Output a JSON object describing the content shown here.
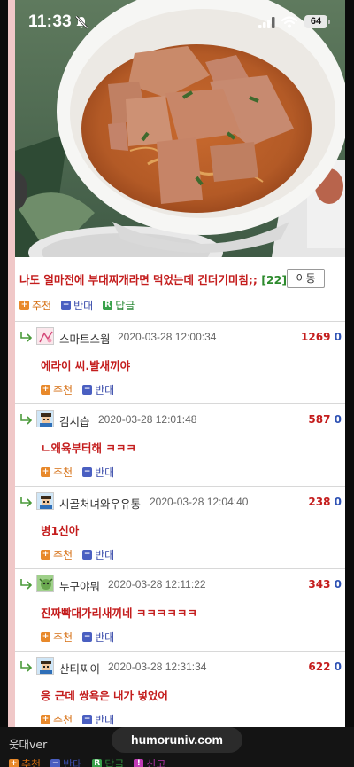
{
  "status_bar": {
    "time": "11:33",
    "battery": "64"
  },
  "post": {
    "title": "나도 얼마전에 부대찌개라면 먹었는데 건더기미침;;",
    "comment_count": "[22]",
    "move_button": "이동",
    "actions": {
      "recommend": "추천",
      "oppose": "반대",
      "reply": "답글"
    }
  },
  "comments": [
    {
      "nick": "스마트스웜",
      "date": "2020-03-28 12:00:34",
      "up": "1269",
      "down": "0",
      "text": "에라이 씨.발새끼야",
      "recommend": "추천",
      "oppose": "반대"
    },
    {
      "nick": "김시습",
      "date": "2020-03-28 12:01:48",
      "up": "587",
      "down": "0",
      "text": "ㄴ왜육부터해 ㅋㅋㅋ",
      "recommend": "추천",
      "oppose": "반대"
    },
    {
      "nick": "시골처녀와우유통",
      "date": "2020-03-28 12:04:40",
      "up": "238",
      "down": "0",
      "text": "병1신아",
      "recommend": "추천",
      "oppose": "반대"
    },
    {
      "nick": "누구야뭐",
      "date": "2020-03-28 12:11:22",
      "up": "343",
      "down": "0",
      "text": "진짜빡대가리새끼네 ㅋㅋㅋㅋㅋㅋ",
      "recommend": "추천",
      "oppose": "반대"
    },
    {
      "nick": "산티찌이",
      "date": "2020-03-28 12:31:34",
      "up": "622",
      "down": "0",
      "text": "응 근데 쌍욕은 내가 넣었어",
      "recommend": "추천",
      "oppose": "반대"
    }
  ],
  "bottom": {
    "next_nick": "웃대ver",
    "url": "humoruniv.com",
    "actions": {
      "recommend": "추천",
      "oppose": "반대",
      "reply": "답글",
      "report": "신고"
    }
  },
  "colors": {
    "title_red": "#c41d1d",
    "count_green": "#2e8b2e",
    "score_blue": "#2f52b4",
    "recommend_orange": "#e8892b",
    "oppose_blue": "#4a5fc1",
    "reply_green": "#38a14a",
    "report_magenta": "#c23ab5"
  },
  "icons": [
    "bell-slash-icon",
    "signal-icon",
    "wifi-icon",
    "battery-icon",
    "reply-arrow-icon",
    "avatar-icon"
  ]
}
